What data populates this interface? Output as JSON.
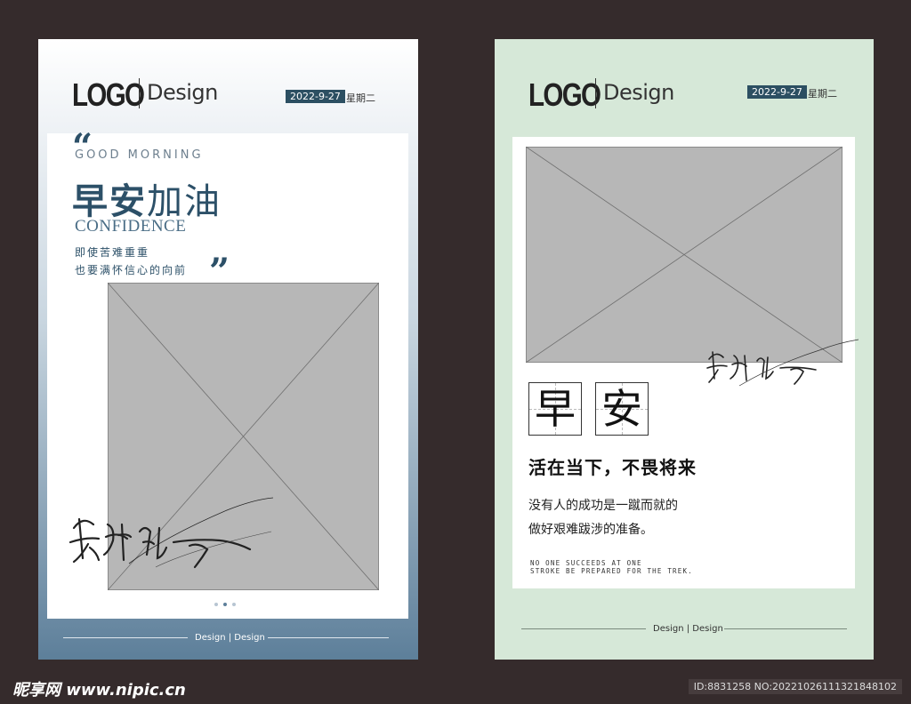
{
  "poster1": {
    "logo": "LOGO",
    "design": "Design",
    "date": "2022-9-27",
    "weekday": "星期二",
    "quote_open": "“",
    "quote_close": "”",
    "greeting_en": "GOOD MORNING",
    "title_bold": "早安",
    "title_light": "加油",
    "subtitle_en": "CONFIDENCE",
    "line1": "即使苦难重重",
    "line2": "也要满怀信心的向前",
    "signature_text": "美好的一天",
    "footer": "Design | Design"
  },
  "poster2": {
    "logo": "LOGO",
    "design": "Design",
    "date": "2022-9-27",
    "weekday": "星期二",
    "char1": "早",
    "char2": "安",
    "signature_text": "美好的一天",
    "slogan": "活在当下，不畏将来",
    "body1": "没有人的成功是一蹴而就的",
    "body2": "做好艰难跋涉的准备。",
    "en1": "NO ONE SUCCEEDS AT ONE",
    "en2": "STROKE BE PREPARED FOR THE TREK.",
    "footer": "Design | Design"
  },
  "watermark": {
    "site": "昵享网 www.nipic.cn",
    "id": "ID:8831258 NO:20221026111321848102"
  },
  "colors": {
    "navy": "#2c5068",
    "date_badge": "#2c4f62",
    "mint_bg": "#d6e8d8",
    "placeholder": "#b7b7b7"
  }
}
